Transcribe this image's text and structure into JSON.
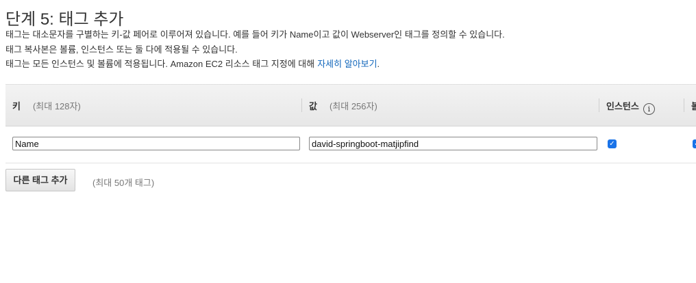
{
  "header": {
    "title": "단계 5: 태그 추가",
    "desc_line1": "태그는 대소문자를 구별하는 키-값 페어로 이루어져 있습니다. 예를 들어 키가 Name이고 값이 Webserver인 태그를 정의할 수 있습니다.",
    "desc_line2": "태그 복사본은 볼륨, 인스턴스 또는 둘 다에 적용될 수 있습니다.",
    "desc_line3": "태그는 모든 인스턴스 및 볼륨에 적용됩니다. Amazon EC2 리소스 태그 지정에 대해",
    "learn_more_link": "자세히 알아보기",
    "desc_line3_end": "."
  },
  "table": {
    "columns": {
      "key_label": "키",
      "key_note": "(최대 128자)",
      "value_label": "값",
      "value_note": "(최대 256자)",
      "instances_label": "인스턴스",
      "info_icon": "i",
      "volumes_label_partial": "볼"
    },
    "rows": [
      {
        "key": "Name",
        "value": "david-springboot-matjipfind",
        "instances_checked": true,
        "volumes_checked": true
      }
    ]
  },
  "footer": {
    "add_tag_button": "다른 태그 추가",
    "max_tags_note": "(최대 50개 태그)"
  },
  "colors": {
    "link": "#1166bb",
    "checkbox": "#1a73e8"
  }
}
